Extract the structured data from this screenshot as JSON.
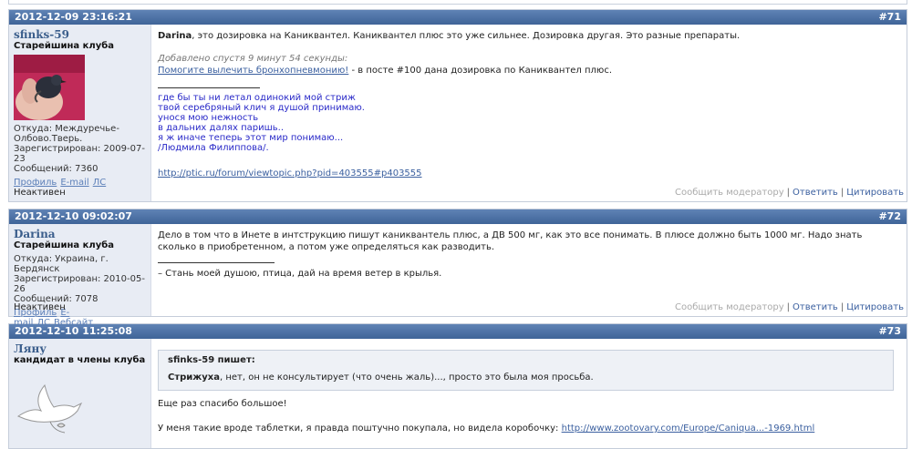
{
  "posts": [
    {
      "date": "2012-12-09 23:16:21",
      "num": "#71",
      "author": {
        "name": "sfinks-59",
        "title": "Старейшина клуба",
        "from": "Откуда: Междуречье-Олбово.Тверь.",
        "registered": "Зарегистрирован: 2009-07-23",
        "messages": "Сообщений: 7360",
        "links": [
          "Профиль",
          "E-mail",
          "ЛС"
        ],
        "status": "Неактивен"
      },
      "content": {
        "bold_name": "Darina",
        "text": ", это дозировка на Каниквантел. Каниквантел плюс это уже сильнее. Дозировка другая. Это разные препараты.",
        "edited": "Добавлено спустя   9 минут  54 секунды:",
        "link_text": "Помогите вылечить бронхопневмонию!",
        "after_link": " - в посте #100 дана дозировка по Каниквантел плюс.",
        "poem": [
          "где бы ты ни летал одинокий мой стриж",
          "твой серебряный  клич я душой принимаю.",
          "унося мою нежность",
          "в дальних далях паришь..",
          "я ж иначе теперь этот мир понимаю...",
          "/Людмила Филиппова/."
        ],
        "sig_link": "http://ptic.ru/forum/viewtopic.php?pid=403555#p403555"
      },
      "actions": {
        "report": "Сообщить модератору",
        "reply": "Ответить",
        "quote": "Цитировать"
      }
    },
    {
      "date": "2012-12-10 09:02:07",
      "num": "#72",
      "author": {
        "name": "Darina",
        "title": "Старейшина клуба",
        "from": "Откуда: Украина, г. Бердянск",
        "registered": "Зарегистрирован: 2010-05-26",
        "messages": "Сообщений: 7078",
        "links": [
          "Профиль",
          "E-mail",
          "ЛС",
          "Вебсайт"
        ],
        "status": "Неактивен"
      },
      "content": {
        "text": "Дело в том что в Инете в интструкцию пишут каниквантель плюс, а ДВ 500 мг, как это все понимать. В плюсе должно быть 1000 мг. Надо знать сколько в приобретенном, а потом уже определяться как разводить.",
        "sig": "– Стань моей душою, птица, дай на время ветер в крылья."
      },
      "actions": {
        "report": "Сообщить модератору",
        "reply": "Ответить",
        "quote": "Цитировать"
      }
    },
    {
      "date": "2012-12-10 11:25:08",
      "num": "#73",
      "author": {
        "name": "Ляну",
        "title": "кандидат в члены клуба"
      },
      "content": {
        "quote_author": "sfinks-59 пишет:",
        "quote_bold": "Стрижуха",
        "quote_text": ", нет, он  не консультирует (что очень жаль)..., просто это была моя просьба.",
        "line1": "Еще раз спасибо большое!",
        "line2": "У меня такие вроде таблетки, я правда поштучно покупала, но видела коробочку: ",
        "line2_link": "http://www.zootovary.com/Europe/Caniqua...-1969.html"
      }
    }
  ],
  "colors": {
    "header_bg": "#4a6fa5",
    "author_bg": "#e8ecf4",
    "link": "#3a5f9f",
    "poem": "#2929c8"
  }
}
